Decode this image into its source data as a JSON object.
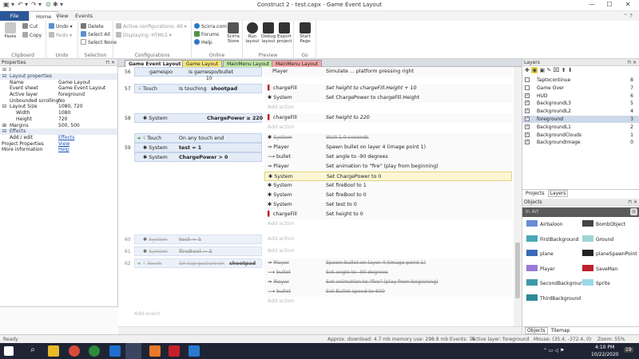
{
  "window": {
    "title": "Construct 2 - test.capx - Game Event Layout",
    "min": "—",
    "max": "☐",
    "close": "✕"
  },
  "quickaccess": [
    "▣",
    "▾",
    "↶",
    "▾",
    "↷",
    "▾",
    "⊙",
    "✱",
    "▾"
  ],
  "ribbon_tabs": [
    "File",
    "Home",
    "View",
    "Events"
  ],
  "ribbon": {
    "paste": "Paste",
    "cut": "Cut",
    "copy": "Copy",
    "clipboard": "Clipboard",
    "undo": "Undo",
    "redo": "Redo",
    "undo_group": "Undo",
    "delete": "Delete",
    "select_all": "Select All",
    "select_none": "Select None",
    "selection": "Selection",
    "active_config": "Active configurations: All",
    "displaying": "Displaying: HTML5",
    "configurations": "Configurations",
    "scirra": "Scirra.com",
    "forums": "Forums",
    "help": "Help",
    "store": "Scirra Store",
    "run": "Run layout",
    "debug": "Debug layout",
    "export": "Export project",
    "online": "Online",
    "preview": "Preview",
    "start": "Start Page",
    "go": "Go"
  },
  "properties": {
    "header": "Properties",
    "section_layout": "Layout properties",
    "rows": [
      {
        "k": "Name",
        "v": "Game Layout"
      },
      {
        "k": "Event sheet",
        "v": "Game Event Layout"
      },
      {
        "k": "Active layer",
        "v": "foreground"
      },
      {
        "k": "Unbounded scrolling",
        "v": "No"
      },
      {
        "k": "Layout Size",
        "v": "1080, 720"
      },
      {
        "k": "Width",
        "v": "1080"
      },
      {
        "k": "Height",
        "v": "720"
      },
      {
        "k": "Margins",
        "v": "500, 500"
      }
    ],
    "effects_section": "Effects",
    "addedit": "Add / edit",
    "effects_link": "Effects",
    "project_props": "Project Properties",
    "view_link": "View",
    "more_info": "More information",
    "help_link": "Help"
  },
  "doctabs": [
    "Game Event Layout",
    "Game Layout",
    "MainMenu Layout",
    "MainMenu Layout"
  ],
  "events": {
    "e56": {
      "num": "56",
      "obj": "gamespo",
      "cond": "is gamespo/bullet",
      "act_obj": "Player",
      "act": "Simulate ... platform pressing right",
      "extra": "10"
    },
    "e57": {
      "num": "57",
      "obj": "Touch",
      "cond": "Is touching",
      "target": "shootpad",
      "a1_obj": "chargeFill",
      "a1": "Set height to chargeFill.Height + 10",
      "a2_obj": "System",
      "a2": "Set ChargePower to chargeFill.Height"
    },
    "e58": {
      "num": "58",
      "obj": "System",
      "cond": "ChargePower ≥ 220",
      "a1_obj": "chargeFill",
      "a1": "Set height to 220"
    },
    "e59": {
      "num": "59",
      "c1_obj": "Touch",
      "c1": "On any touch end",
      "c2_obj": "System",
      "c2": "test = 1",
      "c3_obj": "System",
      "c3": "ChargePower > 0",
      "actions": [
        {
          "obj": "System",
          "text": "Wait 1.0 seconds"
        },
        {
          "obj": "Player",
          "text": "Spawn bullet on layer 4 (image point 1)"
        },
        {
          "obj": "bullet",
          "text": "Set angle to -90 degrees"
        },
        {
          "obj": "Player",
          "text": "Set animation to \"fire\" (play from beginning)"
        },
        {
          "obj": "System",
          "text": "Set ChargePower to 0"
        },
        {
          "obj": "System",
          "text": "Set fireBool to 1"
        },
        {
          "obj": "System",
          "text": "Set fireBool to 0"
        },
        {
          "obj": "System",
          "text": "Set test to 0"
        },
        {
          "obj": "chargeFill",
          "text": "Set height to 0"
        }
      ]
    },
    "e60": {
      "num": "60",
      "obj": "System",
      "cond": "test = 1"
    },
    "e61": {
      "num": "61",
      "obj": "System",
      "cond": "fireBool = 1"
    },
    "e62": {
      "num": "62",
      "obj": "Touch",
      "cond": "On tap gesture on",
      "target": "shootpad",
      "actions": [
        {
          "obj": "Player",
          "text": "Spawn bullet on layer 4 (image point 1)"
        },
        {
          "obj": "bullet",
          "text": "Set angle to -90 degrees"
        },
        {
          "obj": "Player",
          "text": "Set animation to \"fire\" (play from beginning)"
        },
        {
          "obj": "bullet",
          "text": "Set Bullet speed to 600"
        }
      ]
    },
    "add_action": "Add action",
    "add_event": "Add event"
  },
  "layers": {
    "header": "Layers",
    "items": [
      {
        "name": "Taptocontinue",
        "num": "8",
        "checked": false
      },
      {
        "name": "Game Over",
        "num": "7",
        "checked": false
      },
      {
        "name": "HUD",
        "num": "6",
        "checked": true
      },
      {
        "name": "BackgroundL3",
        "num": "5",
        "checked": true
      },
      {
        "name": "BackgroundL2",
        "num": "4",
        "checked": true
      },
      {
        "name": "foreground",
        "num": "3",
        "checked": true
      },
      {
        "name": "BackgroundL1",
        "num": "2",
        "checked": true
      },
      {
        "name": "BackgroundClouds",
        "num": "1",
        "checked": true
      },
      {
        "name": "BackgroundImage",
        "num": "0",
        "checked": true
      }
    ],
    "tab_projects": "Projects",
    "tab_layers": "Layers"
  },
  "objects": {
    "header": "Objects",
    "filter": "In Art",
    "items": [
      {
        "name": "Airbaloon",
        "color": "#6b8bd6"
      },
      {
        "name": "BombObject",
        "color": "#444444"
      },
      {
        "name": "FirstBackground",
        "color": "#4aa6b8"
      },
      {
        "name": "Ground",
        "color": "#9fd4d4"
      },
      {
        "name": "plane",
        "color": "#3b6ab8"
      },
      {
        "name": "planeSpawnPoint",
        "color": "#222222"
      },
      {
        "name": "Player",
        "color": "#9a7ad6"
      },
      {
        "name": "SaveMan",
        "color": "#c0202a"
      },
      {
        "name": "SecondBackground",
        "color": "#3c9aa8"
      },
      {
        "name": "Sprite",
        "color": "#9ad8e8"
      },
      {
        "name": "ThirdBackground",
        "color": "#2e8898"
      }
    ],
    "tab_objects": "Objects",
    "tab_tilemap": "Tilemap"
  },
  "status": {
    "ready": "Ready",
    "download": "Approx. download: 4.7 mb  memory use: 298.8 mb  Events: 75",
    "layer": "Active layer: foreground",
    "mouse": "Mouse: (35.4, -372.4, 0)",
    "zoom": "Zoom: 55%"
  },
  "taskbar": {
    "time": "4:10 PM",
    "date": "10/22/2020",
    "notif": "19"
  }
}
